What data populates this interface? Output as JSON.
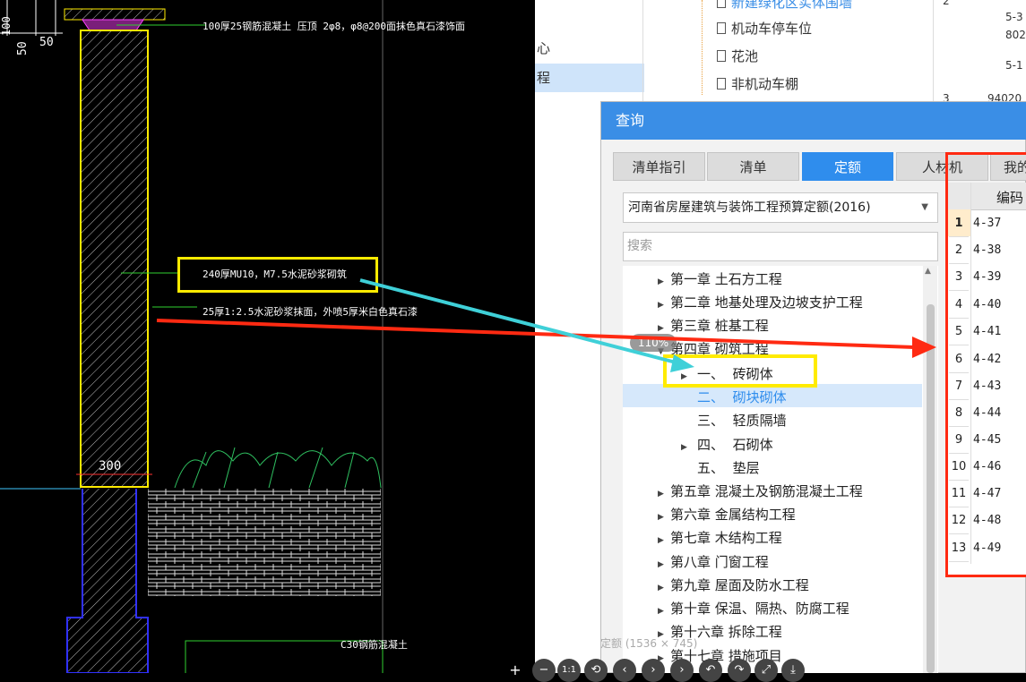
{
  "cad": {
    "dims": {
      "d100": "100",
      "d50a": "50",
      "d50b": "50",
      "d300": "300"
    },
    "note_top": "100厚25钢筋混凝土 压顶 2φ8，φ8@200面抹色真石漆饰面",
    "note_wall": "240厚MU10，M7.5水泥砂浆砌筑",
    "note_plaster": "25厚1:2.5水泥砂浆抹面，外喷5厚米白色真石漆",
    "note_c30": "C30钢筋混凝土"
  },
  "bg_app": {
    "left_tabs": [
      "心",
      "程"
    ],
    "tree_items": [
      "新建绿化区实体围墙",
      "机动车停车位",
      "花池",
      "非机动车棚"
    ],
    "right_fragments": [
      "5-3",
      "802",
      "5-1",
      "2",
      "3",
      "94020"
    ]
  },
  "dialog": {
    "title": "查询",
    "tabs": [
      "清单指引",
      "清单",
      "定额",
      "人材机",
      "我的"
    ],
    "active_tab": "定额",
    "select_value": "河南省房屋建筑与装饰工程预算定额(2016)",
    "search_placeholder": "搜索",
    "zoom_badge": "110%",
    "chapters_top": [
      "第一章 土石方工程",
      "第二章 地基处理及边坡支护工程",
      "第三章 桩基工程",
      "第四章 砌筑工程"
    ],
    "sub_items": [
      {
        "num": "一、",
        "label": "砖砌体"
      },
      {
        "num": "二、",
        "label": "砌块砌体"
      },
      {
        "num": "三、",
        "label": "轻质隔墙"
      },
      {
        "num": "四、",
        "label": "石砌体"
      },
      {
        "num": "五、",
        "label": "垫层"
      }
    ],
    "chapters_bottom": [
      "第五章 混凝土及钢筋混凝土工程",
      "第六章 金属结构工程",
      "第七章 木结构工程",
      "第八章 门窗工程",
      "第九章 屋面及防水工程",
      "第十章 保温、隔热、防腐工程",
      "第十六章 拆除工程",
      "第十七章 措施项目"
    ],
    "table_header": "编码",
    "rows": [
      {
        "n": "1",
        "code": "4-37"
      },
      {
        "n": "2",
        "code": "4-38"
      },
      {
        "n": "3",
        "code": "4-39"
      },
      {
        "n": "4",
        "code": "4-40"
      },
      {
        "n": "5",
        "code": "4-41"
      },
      {
        "n": "6",
        "code": "4-42"
      },
      {
        "n": "7",
        "code": "4-43"
      },
      {
        "n": "8",
        "code": "4-44"
      },
      {
        "n": "9",
        "code": "4-45"
      },
      {
        "n": "10",
        "code": "4-46"
      },
      {
        "n": "11",
        "code": "4-47"
      },
      {
        "n": "12",
        "code": "4-48"
      },
      {
        "n": "13",
        "code": "4-49"
      }
    ]
  },
  "footer_caption": "定额 (1536 × 745)",
  "toolbar": [
    "+",
    "−",
    "1:1",
    "⟲",
    "‹",
    "›",
    "›",
    "↶",
    "↷",
    "⤢",
    "⤓"
  ],
  "colors": {
    "accent": "#2f8ded",
    "highlight_box": "#ffeb00",
    "red_arrow": "#ff2a12",
    "cyan_arrow": "#3fd0d8"
  }
}
